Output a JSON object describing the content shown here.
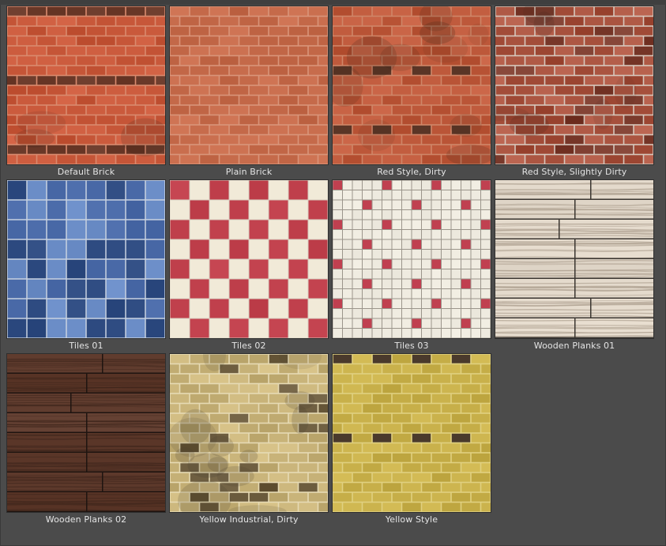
{
  "materials": [
    {
      "id": "default-brick",
      "label": "Default Brick",
      "pattern": "brick",
      "colors": {
        "base": "#c8583a",
        "mortar": "#d98a6e",
        "dark": "#6b3a2a"
      }
    },
    {
      "id": "plain-brick",
      "label": "Plain Brick",
      "pattern": "brick-plain",
      "colors": {
        "base": "#c56a4a",
        "mortar": "#d9957a"
      }
    },
    {
      "id": "red-style-dirty",
      "label": "Red Style, Dirty",
      "pattern": "brick-dirty",
      "colors": {
        "base": "#bf5a3c",
        "mortar": "#cf8668",
        "dark": "#5a3526"
      }
    },
    {
      "id": "red-style-slightly-dirty",
      "label": "Red Style, Slightly Dirty",
      "pattern": "brick-slight",
      "colors": {
        "base": "#a8523e",
        "mortar": "#d7c8bd",
        "dark": "#7a3a2c"
      }
    },
    {
      "id": "tiles-01",
      "label": "Tiles 01",
      "pattern": "tiles-blue",
      "colors": {
        "base": "#4a6aa8",
        "mortar": "#c9d2e0",
        "dark": "#2d4a80",
        "light": "#6a8cc6"
      }
    },
    {
      "id": "tiles-02",
      "label": "Tiles 02",
      "pattern": "tiles-check",
      "colors": {
        "base": "#c0404c",
        "mortar": "#d8d0c2",
        "light": "#f1ead8"
      }
    },
    {
      "id": "tiles-03",
      "label": "Tiles 03",
      "pattern": "tiles-small",
      "colors": {
        "base": "#efebe0",
        "mortar": "#9b958b",
        "accent": "#c04050"
      }
    },
    {
      "id": "wooden-planks-01",
      "label": "Wooden Planks 01",
      "pattern": "planks-light",
      "colors": {
        "base": "#e0d6c8",
        "mortar": "#3a3530",
        "grain": "#b3a595"
      }
    },
    {
      "id": "wooden-planks-02",
      "label": "Wooden Planks 02",
      "pattern": "planks-dark",
      "colors": {
        "base": "#5e3a2c",
        "mortar": "#1e1410",
        "grain": "#3f261c"
      }
    },
    {
      "id": "yellow-industrial-dirty",
      "label": "Yellow Industrial, Dirty",
      "pattern": "brick-yellow-dirty",
      "colors": {
        "base": "#c9b47a",
        "mortar": "#e6dab4",
        "dark": "#6a5a3c"
      }
    },
    {
      "id": "yellow-style",
      "label": "Yellow Style",
      "pattern": "brick-yellow",
      "colors": {
        "base": "#c8b04a",
        "mortar": "#e0d080",
        "dark": "#4a3a2c"
      }
    }
  ]
}
